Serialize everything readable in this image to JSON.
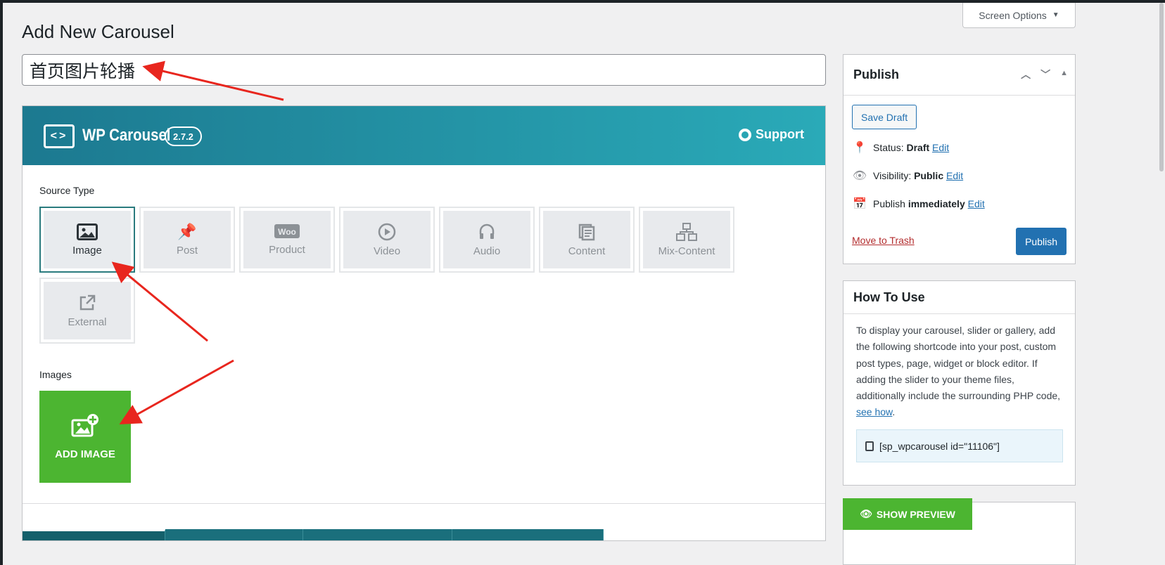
{
  "page": {
    "title": "Add New Carousel",
    "screen_options_label": "Screen Options"
  },
  "title_field": {
    "value": "首页图片轮播"
  },
  "wp_carousel": {
    "brand": "WP Carousel",
    "version": "2.7.2",
    "support_label": "Support"
  },
  "source_type": {
    "label": "Source Type",
    "selected": "Image",
    "options": [
      {
        "label": "Image",
        "icon": "image-icon"
      },
      {
        "label": "Post",
        "icon": "pin-icon"
      },
      {
        "label": "Product",
        "icon": "woo-icon"
      },
      {
        "label": "Video",
        "icon": "play-icon"
      },
      {
        "label": "Audio",
        "icon": "headphones-icon"
      },
      {
        "label": "Content",
        "icon": "content-icon"
      },
      {
        "label": "Mix-Content",
        "icon": "mix-icon"
      },
      {
        "label": "External",
        "icon": "external-link-icon"
      }
    ]
  },
  "images": {
    "label": "Images",
    "add_button": "ADD IMAGE"
  },
  "publish": {
    "title": "Publish",
    "save_draft": "Save Draft",
    "status_label": "Status:",
    "status_value": "Draft",
    "visibility_label": "Visibility:",
    "visibility_value": "Public",
    "publish_label": "Publish",
    "publish_value": "immediately",
    "edit_link": "Edit",
    "move_to_trash": "Move to Trash",
    "publish_button": "Publish"
  },
  "how_to_use": {
    "title": "How To Use",
    "text": "To display your carousel, slider or gallery, add the following shortcode into your post, custom post types, page, widget or block editor. If adding the slider to your theme files, additionally include the surrounding PHP code,",
    "see_how": "see how",
    "period": ".",
    "shortcode": "[sp_wpcarousel id=\"11106\"]"
  },
  "preview": {
    "show_preview": "SHOW PREVIEW"
  },
  "colors": {
    "accent_blue": "#2271b1",
    "green": "#4cb531",
    "teal_start": "#1c7990",
    "teal_end": "#2aaab8",
    "annotation_red": "#e8261e"
  }
}
